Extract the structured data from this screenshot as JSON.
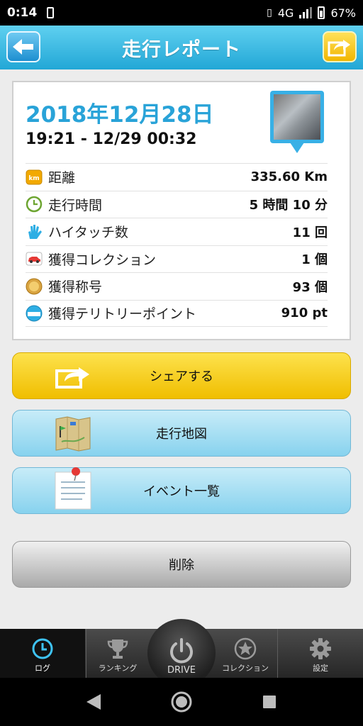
{
  "status_bar": {
    "time": "0:14",
    "network": "4G",
    "battery": "67%"
  },
  "header": {
    "title": "走行レポート",
    "back_icon": "arrow-left-icon",
    "share_icon": "share-icon"
  },
  "report": {
    "date": "2018年12月28日",
    "time_range": "19:21 - 12/29 00:32",
    "rows": [
      {
        "icon": "km-icon",
        "label": "距離",
        "value": "335.60 Km"
      },
      {
        "icon": "clock-icon",
        "label": "走行時間",
        "value": "5 時間 10 分"
      },
      {
        "icon": "high-five-icon",
        "label": "ハイタッチ数",
        "value": "11 回"
      },
      {
        "icon": "car-collection-icon",
        "label": "獲得コレクション",
        "value": "1 個"
      },
      {
        "icon": "medal-icon",
        "label": "獲得称号",
        "value": "93 個"
      },
      {
        "icon": "spot-icon",
        "label": "獲得テリトリーポイント",
        "value": "910 pt"
      }
    ]
  },
  "buttons": {
    "share": "シェアする",
    "route_map": "走行地図",
    "event_list": "イベント一覧",
    "delete": "削除"
  },
  "tabs": [
    {
      "label": "ログ",
      "icon": "log-clock-icon",
      "active": true
    },
    {
      "label": "ランキング",
      "icon": "trophy-icon"
    },
    {
      "label": "DRIVE",
      "icon": "power-icon"
    },
    {
      "label": "コレクション",
      "icon": "star-icon"
    },
    {
      "label": "設定",
      "icon": "gear-icon"
    }
  ],
  "colors": {
    "accent": "#29a3d8",
    "header": "#22a7d6",
    "share_button": "#f6c800",
    "secondary_button": "#9fdcf2"
  }
}
